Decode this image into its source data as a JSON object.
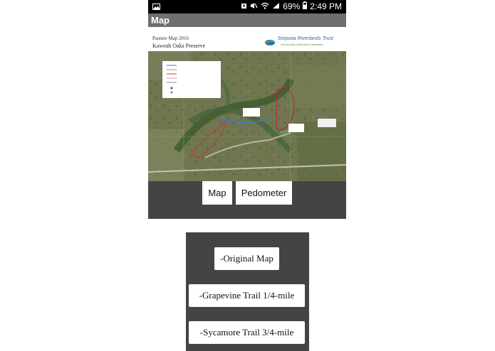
{
  "status_bar": {
    "battery": "69%",
    "time": "2:49 PM"
  },
  "app_bar": {
    "title": "Map"
  },
  "map_image": {
    "title_line1": "Pasture Map 2016",
    "title_line2": "Kaweah Oaks Preserve",
    "org_name": "Sequoia Riverlands Trust",
    "org_tagline": "Conserving California's Heartland"
  },
  "nav": {
    "map_label": "Map",
    "pedometer_label": "Pedometer"
  },
  "submenu": {
    "items": [
      {
        "label": "-Original Map"
      },
      {
        "label": "-Grapevine Trail 1/4-mile"
      },
      {
        "label": "-Sycamore Trail 3/4-mile"
      }
    ]
  }
}
